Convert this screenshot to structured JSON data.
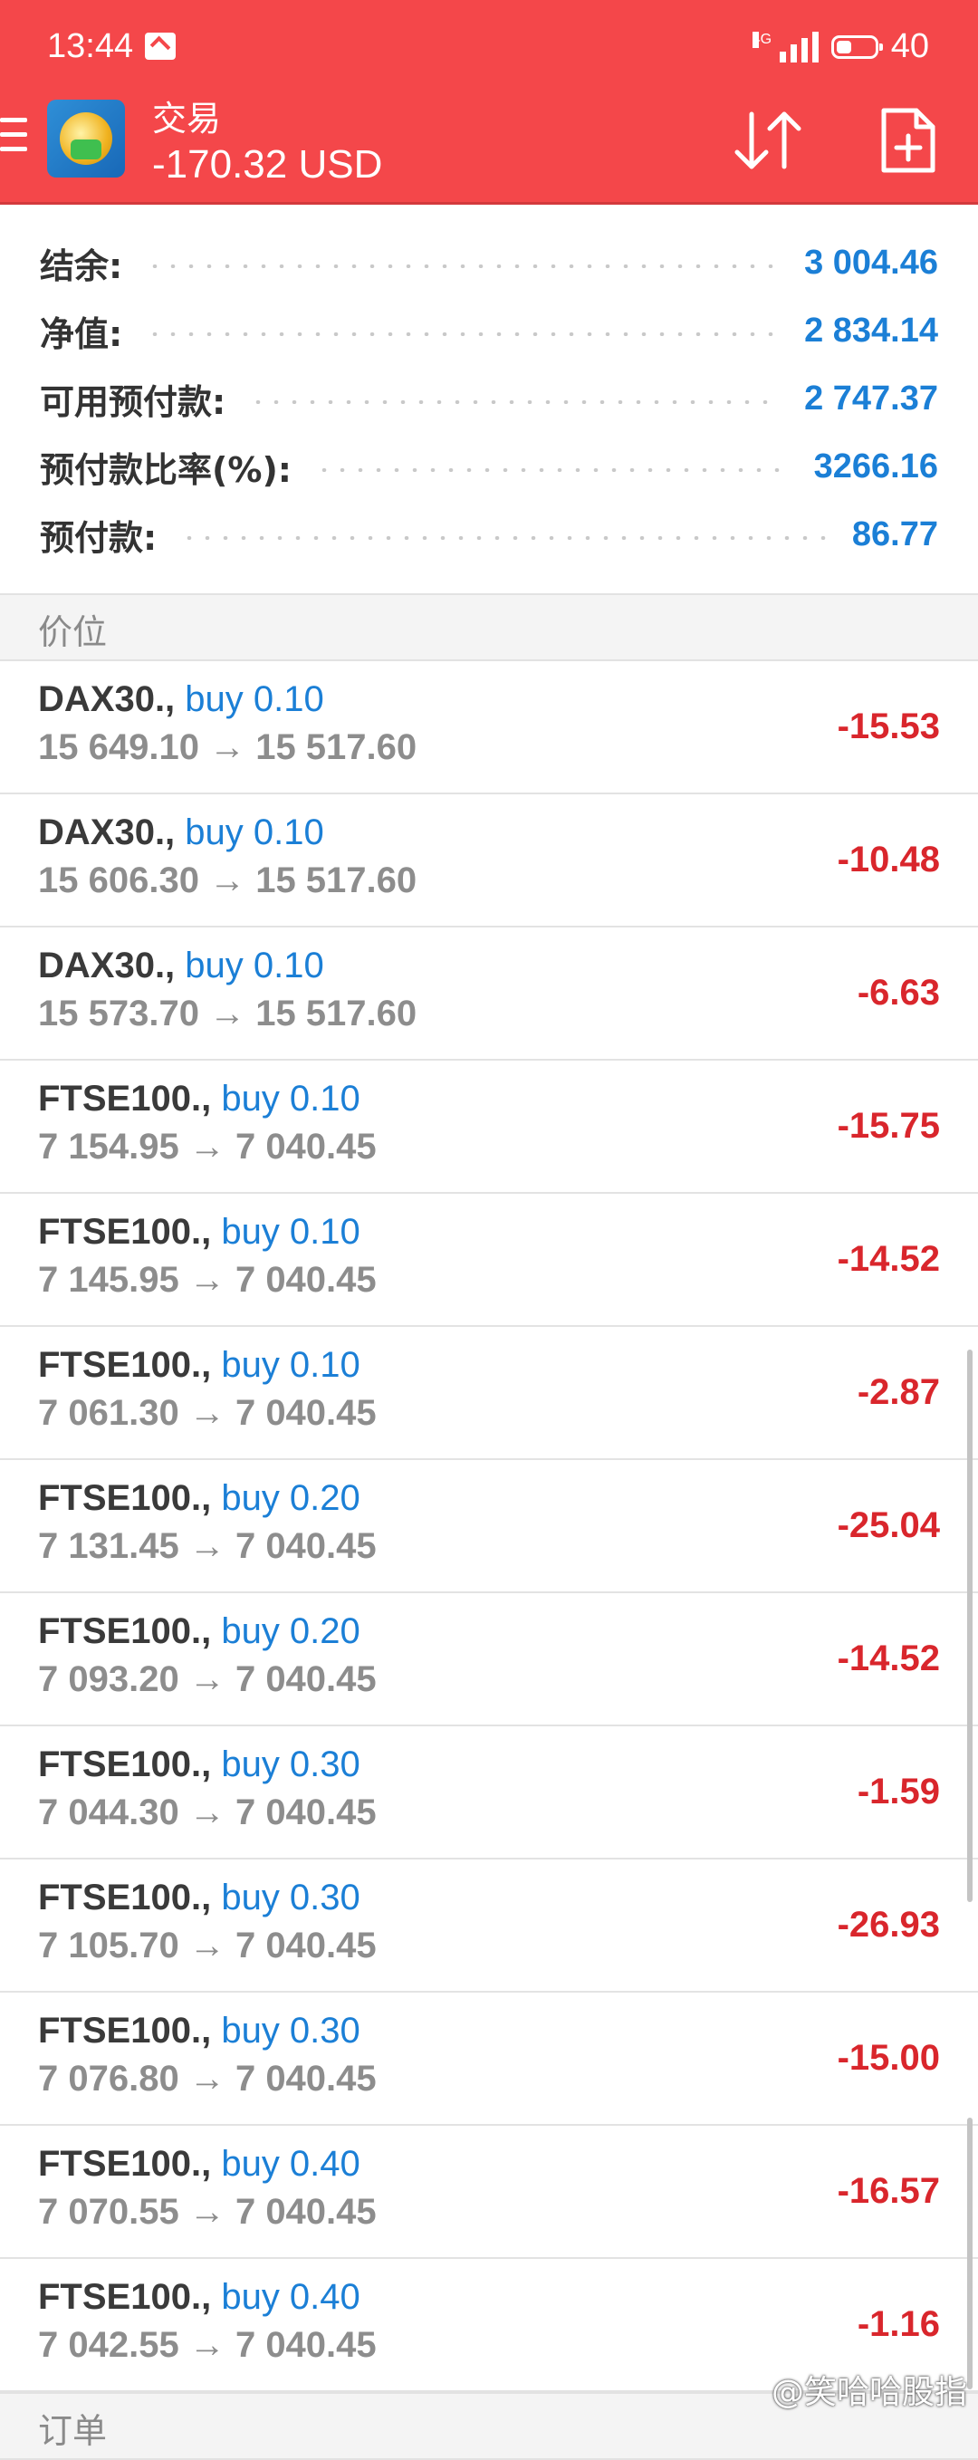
{
  "status_bar": {
    "time": "13:44",
    "network": "4G",
    "battery": "40",
    "battery_level_percent": 40
  },
  "header": {
    "title": "交易",
    "balance": "-170.32 USD",
    "icons": [
      "menu-icon",
      "metatrader-logo",
      "sort-icon",
      "add-order-icon"
    ]
  },
  "summary": [
    {
      "label": "结余:",
      "value": "3 004.46"
    },
    {
      "label": "净值:",
      "value": "2 834.14"
    },
    {
      "label": "可用预付款:",
      "value": "2 747.37"
    },
    {
      "label": "预付款比率(%):",
      "value": "3266.16"
    },
    {
      "label": "预付款:",
      "value": "86.77"
    }
  ],
  "sections": {
    "positions": "价位",
    "orders": "订单"
  },
  "positions": [
    {
      "symbol": "DAX30.,",
      "type": "buy 0.10",
      "open": "15 649.10",
      "current": "15 517.60",
      "profit": "-15.53"
    },
    {
      "symbol": "DAX30.,",
      "type": "buy 0.10",
      "open": "15 606.30",
      "current": "15 517.60",
      "profit": "-10.48"
    },
    {
      "symbol": "DAX30.,",
      "type": "buy 0.10",
      "open": "15 573.70",
      "current": "15 517.60",
      "profit": "-6.63"
    },
    {
      "symbol": "FTSE100.,",
      "type": "buy 0.10",
      "open": "7 154.95",
      "current": "7 040.45",
      "profit": "-15.75"
    },
    {
      "symbol": "FTSE100.,",
      "type": "buy 0.10",
      "open": "7 145.95",
      "current": "7 040.45",
      "profit": "-14.52"
    },
    {
      "symbol": "FTSE100.,",
      "type": "buy 0.10",
      "open": "7 061.30",
      "current": "7 040.45",
      "profit": "-2.87"
    },
    {
      "symbol": "FTSE100.,",
      "type": "buy 0.20",
      "open": "7 131.45",
      "current": "7 040.45",
      "profit": "-25.04"
    },
    {
      "symbol": "FTSE100.,",
      "type": "buy 0.20",
      "open": "7 093.20",
      "current": "7 040.45",
      "profit": "-14.52"
    },
    {
      "symbol": "FTSE100.,",
      "type": "buy 0.30",
      "open": "7 044.30",
      "current": "7 040.45",
      "profit": "-1.59"
    },
    {
      "symbol": "FTSE100.,",
      "type": "buy 0.30",
      "open": "7 105.70",
      "current": "7 040.45",
      "profit": "-26.93"
    },
    {
      "symbol": "FTSE100.,",
      "type": "buy 0.30",
      "open": "7 076.80",
      "current": "7 040.45",
      "profit": "-15.00"
    },
    {
      "symbol": "FTSE100.,",
      "type": "buy 0.40",
      "open": "7 070.55",
      "current": "7 040.45",
      "profit": "-16.57"
    },
    {
      "symbol": "FTSE100.,",
      "type": "buy 0.40",
      "open": "7 042.55",
      "current": "7 040.45",
      "profit": "-1.16"
    }
  ],
  "arrow_glyph": "→",
  "watermark": "@笑哈哈股指",
  "colors": {
    "header_bg": "#f4474a",
    "value_blue": "#1b7fd6",
    "loss_red": "#d9262c"
  }
}
